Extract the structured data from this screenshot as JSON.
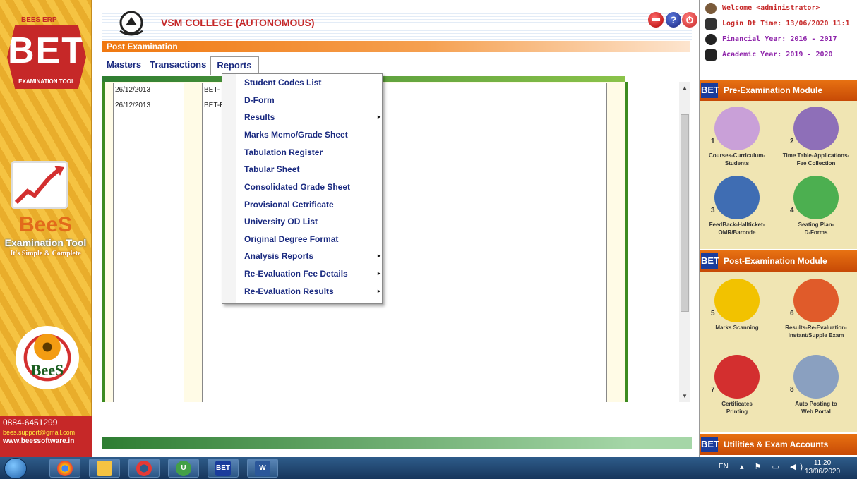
{
  "left_banner": {
    "brand_small": "BEES ERP",
    "bet": "BET",
    "bet_sub": "EXAMINATION TOOL",
    "title": "BeeS",
    "subtitle": "Examination Tool",
    "tagline": "It's Simple & Complete",
    "flower_label": "BeeS",
    "phone": "0884-6451299",
    "email": "bees.support@gmail.com",
    "website": "www.beessoftware.in"
  },
  "header": {
    "college_name": "VSM COLLEGE (AUTONOMOUS)",
    "section": "Post Examination",
    "icons": [
      "exit-icon",
      "help-icon",
      "power-icon"
    ]
  },
  "menubar": {
    "items": [
      "Masters",
      "Transactions",
      "Reports"
    ],
    "active": "Reports"
  },
  "grid": {
    "rows": [
      {
        "date": "26/12/2013",
        "code": "BET-"
      },
      {
        "date": "26/12/2013",
        "code": "BET-E"
      }
    ]
  },
  "reports_menu": {
    "items": [
      {
        "label": "Student Codes List",
        "submenu": false
      },
      {
        "label": "D-Form",
        "submenu": false
      },
      {
        "label": "Results",
        "submenu": true
      },
      {
        "label": "Marks Memo/Grade Sheet",
        "submenu": false
      },
      {
        "label": "Tabulation Register",
        "submenu": false
      },
      {
        "label": "Tabular Sheet",
        "submenu": false
      },
      {
        "label": "Consolidated Grade Sheet",
        "submenu": false
      },
      {
        "label": "Provisional Cetrificate",
        "submenu": false
      },
      {
        "label": "University OD List",
        "submenu": false
      },
      {
        "label": "Original Degree Format",
        "submenu": false
      },
      {
        "label": "Analysis Reports",
        "submenu": true
      },
      {
        "label": "Re-Evaluation Fee Details",
        "submenu": true
      },
      {
        "label": "Re-Evaluation Results",
        "submenu": true
      }
    ],
    "submenu_arrow": "▸"
  },
  "right_panel": {
    "welcome": "Welcome <administrator>",
    "login": "Login Dt  Time: 13/06/2020 11:1",
    "financial_year": "Financial Year: 2016 - 2017",
    "academic_year": "Academic Year: 2019 - 2020",
    "pre_module_title": "Pre-Examination Module",
    "pre_modules": [
      {
        "num": "1",
        "label": "Courses-Curriculum-\nStudents",
        "color": "#c9a0d8"
      },
      {
        "num": "2",
        "label": "Time Table-Applications-\nFee Collection",
        "color": "#8e6fb8"
      },
      {
        "num": "3",
        "label": "FeedBack-Hallticket-\nOMR/Barcode",
        "color": "#3f6db3"
      },
      {
        "num": "4",
        "label": "Seating Plan-\nD-Forms",
        "color": "#4caf50"
      }
    ],
    "post_module_title": "Post-Examination Module",
    "post_modules": [
      {
        "num": "5",
        "label": "Marks Scanning",
        "color": "#f2c200"
      },
      {
        "num": "6",
        "label": "Results-Re-Evaluation-\nInstant/Supple Exam",
        "color": "#e05b2a"
      },
      {
        "num": "7",
        "label": "Certificates\nPrinting",
        "color": "#d32f2f"
      },
      {
        "num": "8",
        "label": "Auto Posting to\nWeb Portal",
        "color": "#8aa0c0"
      }
    ],
    "utilities_title": "Utilities & Exam Accounts"
  },
  "taskbar": {
    "apps": [
      "chrome-icon",
      "file-explorer-icon",
      "opera-icon",
      "utorrent-icon",
      "bet-app-icon",
      "word-icon"
    ],
    "lang": "EN",
    "tray": "▴ ⚑ ▭ ◀)",
    "time": "11:20",
    "date": "13/06/2020",
    "colors": {
      "accent": "#f07810",
      "menu_text": "#1a2a80",
      "college_red": "#c62828"
    }
  }
}
